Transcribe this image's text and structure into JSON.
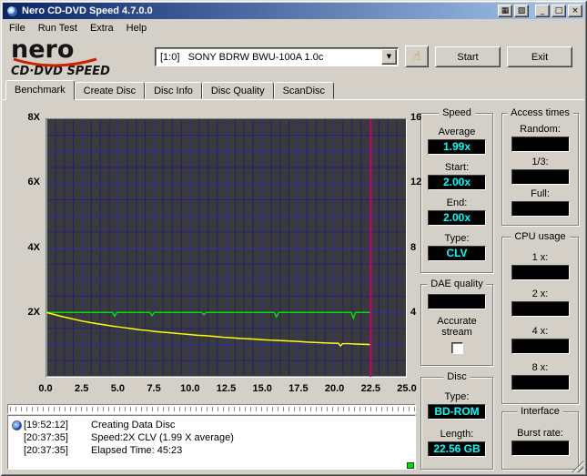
{
  "window": {
    "title": "Nero CD-DVD Speed 4.7.0.0",
    "titlebar_buttons": [
      {
        "name": "shortcut-grid",
        "glyph": "▦"
      },
      {
        "name": "shortcut-panel",
        "glyph": "▨"
      },
      {
        "name": "minimize",
        "glyph": "_"
      },
      {
        "name": "maximize",
        "glyph": "□"
      },
      {
        "name": "close",
        "glyph": "×"
      }
    ]
  },
  "menu": {
    "items": [
      "File",
      "Run Test",
      "Extra",
      "Help"
    ]
  },
  "toolbar": {
    "logo_top": "nero",
    "logo_bottom": "CD·DVD SPEED",
    "drive_selector_value": "[1:0]   SONY BDRW BWU-100A 1.0c",
    "dropdown_arrow": "▼",
    "hand_button_glyph": "☝",
    "start_label": "Start",
    "exit_label": "Exit"
  },
  "tabs": {
    "items": [
      {
        "label": "Benchmark",
        "active": true
      },
      {
        "label": "Create Disc",
        "active": false
      },
      {
        "label": "Disc Info",
        "active": false
      },
      {
        "label": "Disc Quality",
        "active": false
      },
      {
        "label": "ScanDisc",
        "active": false
      }
    ]
  },
  "panels": {
    "speed": {
      "title": "Speed",
      "fields": [
        {
          "label": "Average",
          "value": "1.99x"
        },
        {
          "label": "Start:",
          "value": "2.00x"
        },
        {
          "label": "End:",
          "value": "2.00x"
        },
        {
          "label": "Type:",
          "value": "CLV"
        }
      ]
    },
    "access_times": {
      "title": "Access times",
      "fields": [
        {
          "label": "Random:",
          "value": ""
        },
        {
          "label": "1/3:",
          "value": ""
        },
        {
          "label": "Full:",
          "value": ""
        }
      ]
    },
    "cpu_usage": {
      "title": "CPU usage",
      "fields": [
        {
          "label": "1 x:",
          "value": ""
        },
        {
          "label": "2 x:",
          "value": ""
        },
        {
          "label": "4 x:",
          "value": ""
        },
        {
          "label": "8 x:",
          "value": ""
        }
      ]
    },
    "dae_quality": {
      "title": "DAE quality",
      "value": "",
      "checkbox_label": "Accurate stream",
      "checked": false
    },
    "disc": {
      "title": "Disc",
      "fields": [
        {
          "label": "Type:",
          "value": "BD-ROM"
        },
        {
          "label": "Length:",
          "value": "22.56 GB"
        }
      ]
    },
    "interface": {
      "title": "Interface",
      "fields": [
        {
          "label": "Burst rate:",
          "value": ""
        }
      ]
    }
  },
  "log": {
    "entries": [
      {
        "time": "[19:52:12]",
        "text": "Creating Data Disc",
        "icon": "disc-write-icon"
      },
      {
        "time": "[20:37:35]",
        "text": "Speed:2X CLV (1.99 X average)",
        "icon": ""
      },
      {
        "time": "[20:37:35]",
        "text": "Elapsed Time: 45:23",
        "icon": ""
      }
    ]
  },
  "chart_data": {
    "type": "line",
    "title": "",
    "xlim": [
      0,
      25
    ],
    "ylim_left": [
      0,
      8
    ],
    "ylim_right": [
      0,
      16
    ],
    "x_ticks": [
      {
        "v": 0,
        "label": "0.0"
      },
      {
        "v": 2.5,
        "label": "2.5"
      },
      {
        "v": 5,
        "label": "5.0"
      },
      {
        "v": 7.5,
        "label": "7.5"
      },
      {
        "v": 10,
        "label": "10.0"
      },
      {
        "v": 12.5,
        "label": "12.5"
      },
      {
        "v": 15,
        "label": "15.0"
      },
      {
        "v": 17.5,
        "label": "17.5"
      },
      {
        "v": 20,
        "label": "20.0"
      },
      {
        "v": 22.5,
        "label": "22.5"
      },
      {
        "v": 25,
        "label": "25.0"
      }
    ],
    "y_ticks_left": [
      {
        "v": 2,
        "label": "2X"
      },
      {
        "v": 4,
        "label": "4X"
      },
      {
        "v": 6,
        "label": "6X"
      },
      {
        "v": 8,
        "label": "8X"
      }
    ],
    "y_ticks_right": [
      {
        "v": 2,
        "label": "4"
      },
      {
        "v": 4,
        "label": "8"
      },
      {
        "v": 6,
        "label": "12"
      },
      {
        "v": 8,
        "label": "16"
      }
    ],
    "grid": {
      "x_step": 0.625,
      "x_major_step": 2.5,
      "y_step": 0.5,
      "y_major_step": 1,
      "minor_color": "#20207e",
      "major_color": "#2e2eb0"
    },
    "plot_background": "#3a3a3a",
    "marker": {
      "x": 22.56,
      "color": "#cc0066"
    },
    "series": [
      {
        "name": "read-speed",
        "color": "#00dd00",
        "points": [
          [
            0,
            2.0
          ],
          [
            4.6,
            2.0
          ],
          [
            4.75,
            1.88
          ],
          [
            4.9,
            2.0
          ],
          [
            7.2,
            2.0
          ],
          [
            7.35,
            1.9
          ],
          [
            7.5,
            2.0
          ],
          [
            10.8,
            2.0
          ],
          [
            10.95,
            1.93
          ],
          [
            11.1,
            2.0
          ],
          [
            15.85,
            2.0
          ],
          [
            16,
            1.86
          ],
          [
            16.15,
            2.0
          ],
          [
            21.2,
            2.0
          ],
          [
            21.35,
            1.82
          ],
          [
            21.5,
            2.0
          ],
          [
            22.56,
            2.0
          ]
        ]
      },
      {
        "name": "rotation-speed",
        "color": "#ffff00",
        "points": [
          [
            0,
            2.0
          ],
          [
            0.5,
            1.94
          ],
          [
            1,
            1.88
          ],
          [
            1.5,
            1.83
          ],
          [
            2,
            1.78
          ],
          [
            2.5,
            1.73
          ],
          [
            3,
            1.69
          ],
          [
            3.5,
            1.65
          ],
          [
            4,
            1.62
          ],
          [
            4.5,
            1.58
          ],
          [
            5,
            1.55
          ],
          [
            5.5,
            1.52
          ],
          [
            6,
            1.49
          ],
          [
            6.5,
            1.46
          ],
          [
            7,
            1.44
          ],
          [
            7.5,
            1.41
          ],
          [
            8,
            1.39
          ],
          [
            8.5,
            1.37
          ],
          [
            9,
            1.35
          ],
          [
            9.5,
            1.33
          ],
          [
            10,
            1.31
          ],
          [
            10.5,
            1.29
          ],
          [
            11,
            1.28
          ],
          [
            11.5,
            1.26
          ],
          [
            12,
            1.24
          ],
          [
            12.5,
            1.22
          ],
          [
            13,
            1.21
          ],
          [
            13.5,
            1.19
          ],
          [
            14,
            1.18
          ],
          [
            14.5,
            1.17
          ],
          [
            15,
            1.15
          ],
          [
            15.5,
            1.14
          ],
          [
            16,
            1.13
          ],
          [
            16.5,
            1.12
          ],
          [
            17,
            1.11
          ],
          [
            17.5,
            1.1
          ],
          [
            18,
            1.08
          ],
          [
            18.5,
            1.07
          ],
          [
            19,
            1.06
          ],
          [
            19.5,
            1.05
          ],
          [
            20,
            1.04
          ],
          [
            20.3,
            1.04
          ],
          [
            20.45,
            0.96
          ],
          [
            20.6,
            1.03
          ],
          [
            21,
            1.03
          ],
          [
            21.5,
            1.02
          ],
          [
            22,
            1.01
          ],
          [
            22.56,
            1.0
          ]
        ]
      }
    ]
  },
  "colors": {
    "window_bg": "#d4d0c8",
    "titlebar_left": "#0a246a",
    "titlebar_right": "#a6caf0",
    "value_text": "#00ffff",
    "field_bg": "#000000",
    "led": "#00dd00"
  }
}
